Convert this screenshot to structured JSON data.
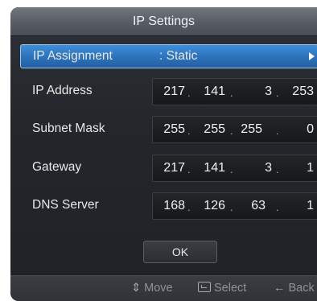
{
  "title": "IP Settings",
  "ip_assignment": {
    "label": "IP Assignment",
    "value": ": Static"
  },
  "rows": [
    {
      "label": "IP Address",
      "octets": [
        "217",
        "141",
        "3",
        "253"
      ]
    },
    {
      "label": "Subnet Mask",
      "octets": [
        "255",
        "255",
        "255",
        "0"
      ]
    },
    {
      "label": "Gateway",
      "octets": [
        "217",
        "141",
        "3",
        "1"
      ]
    },
    {
      "label": "DNS Server",
      "octets": [
        "168",
        "126",
        "63",
        "1"
      ]
    }
  ],
  "separator": ".",
  "ok_label": "OK",
  "footer": {
    "move": "Move",
    "select": "Select",
    "back": "Back"
  },
  "colors": {
    "highlight": "#2d74bd",
    "panel": "#23262b",
    "title_bar": "#575c64"
  }
}
